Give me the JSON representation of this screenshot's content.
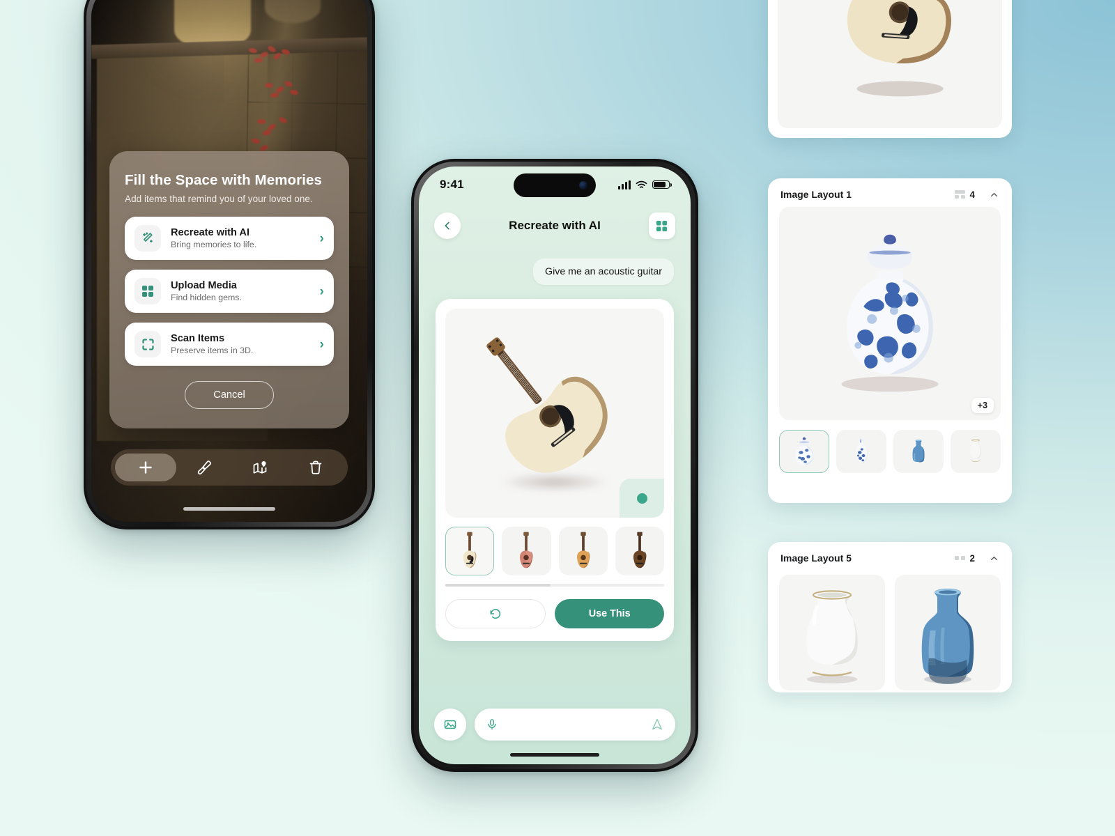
{
  "theme": {
    "accent": "#35917a",
    "accent_light": "#8fc9b6",
    "page_bg_top_right": "#8cc3d6",
    "page_bg_bottom_left": "#e9f8f2",
    "phone_screen_bg": "#d8ecdf"
  },
  "left_phone": {
    "sheet": {
      "title": "Fill the Space with Memories",
      "subtitle": "Add items that remind you of your loved one.",
      "options": [
        {
          "icon": "magic-wand-icon",
          "title": "Recreate with AI",
          "subtitle": "Bring memories to life.",
          "chevron": "›"
        },
        {
          "icon": "grid-squares-icon",
          "title": "Upload Media",
          "subtitle": "Find hidden gems.",
          "chevron": "›"
        },
        {
          "icon": "scan-frame-icon",
          "title": "Scan Items",
          "subtitle": "Preserve items in 3D.",
          "chevron": "›"
        }
      ],
      "cancel_label": "Cancel"
    },
    "toolbar": [
      {
        "icon": "plus-icon",
        "name": "add-button"
      },
      {
        "icon": "paintbrush-icon",
        "name": "brush-button"
      },
      {
        "icon": "map-pin-icon",
        "name": "map-button"
      },
      {
        "icon": "trash-icon",
        "name": "delete-button"
      }
    ]
  },
  "center_phone": {
    "status": {
      "time": "9:41",
      "signal": "cellular-bars-icon",
      "wifi": "wifi-icon",
      "battery": "battery-icon"
    },
    "nav": {
      "back_icon": "chevron-left-icon",
      "title": "Recreate with AI",
      "grid_icon": "grid-squares-icon"
    },
    "message": "Give me an acoustic guitar",
    "preview": {
      "item": "acoustic-guitar",
      "status_dot": "selected-dot"
    },
    "thumbnails": [
      {
        "label": "natural acoustic guitar",
        "selected": true
      },
      {
        "label": "pink sunburst guitar",
        "selected": false
      },
      {
        "label": "amber dreadnought guitar",
        "selected": false
      },
      {
        "label": "dark mahogany guitar",
        "selected": false
      }
    ],
    "actions": {
      "undo_icon": "undo-arrow-icon",
      "use_label": "Use This"
    },
    "composer": {
      "image_icon": "image-icon",
      "mic_icon": "microphone-icon",
      "send_icon": "send-paperplane-icon",
      "placeholder": ""
    }
  },
  "right_panels": [
    {
      "id": "card-top",
      "title": "",
      "main_item": "acoustic-guitar"
    },
    {
      "id": "card-l1",
      "title": "Image Layout 1",
      "count": "4",
      "count_icon": "layout-grid-icon",
      "collapse_icon": "chevron-up-icon",
      "overflow_badge": "+3",
      "main_item": "blue-white-ginger-jar",
      "thumbnails": [
        {
          "label": "blue and white ginger jar",
          "selected": true
        },
        {
          "label": "blue floral gourd vase",
          "selected": false
        },
        {
          "label": "blue glass bottle vase",
          "selected": false
        },
        {
          "label": "white porcelain vase",
          "selected": false
        }
      ]
    },
    {
      "id": "card-l5",
      "title": "Image Layout 5",
      "count": "2",
      "count_icon": "layout-dots-icon",
      "collapse_icon": "chevron-up-icon",
      "items": [
        {
          "label": "white gold-rim vase"
        },
        {
          "label": "blue glass vase"
        }
      ]
    }
  ]
}
